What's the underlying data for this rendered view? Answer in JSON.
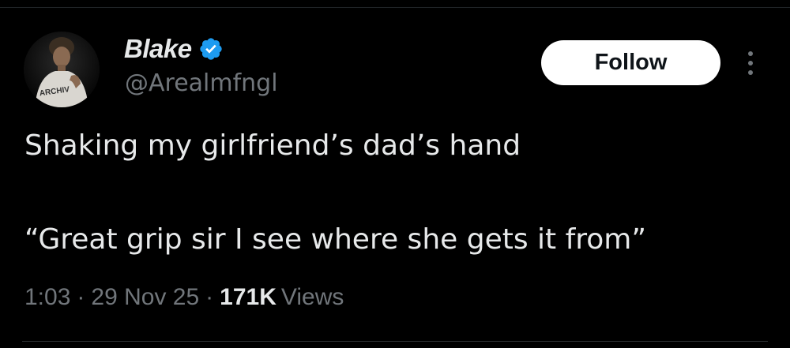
{
  "user": {
    "display_name": "Blake",
    "handle": "@Arealmfngl",
    "verified": true,
    "avatar_shirt_text": "ARCHIV"
  },
  "actions": {
    "follow_label": "Follow",
    "more_icon": "more-vertical-icon"
  },
  "tweet": {
    "line1": "Shaking my girlfriend’s dad’s hand",
    "line2": "“Great grip sir I see where she gets it from”"
  },
  "meta": {
    "time": "1:03",
    "separator": "·",
    "date": "29 Nov 25",
    "views_count": "171K",
    "views_label": "Views"
  },
  "colors": {
    "background": "#000000",
    "primary_text": "#e7e9ea",
    "secondary_text": "#71767b",
    "verified_blue": "#1d9bf0",
    "follow_bg": "#ffffff",
    "follow_text": "#0f1419"
  }
}
